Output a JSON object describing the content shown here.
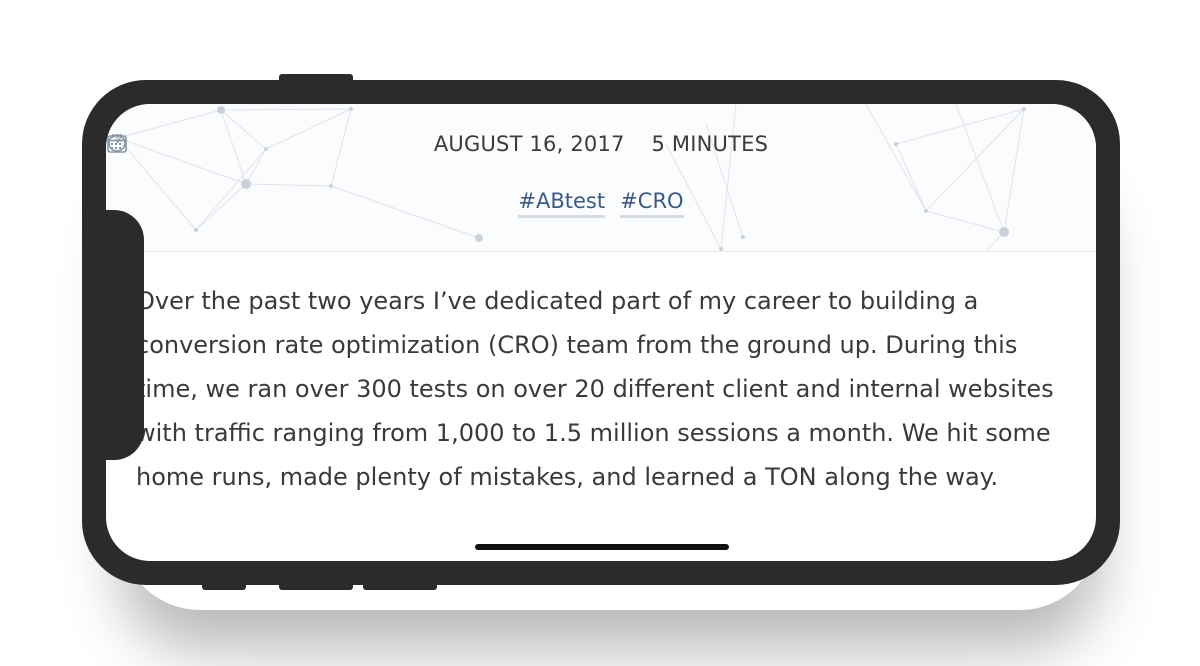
{
  "post": {
    "date": "AUGUST 16, 2017",
    "read_time": "5 MINUTES",
    "tags": [
      "#ABtest",
      "#CRO"
    ],
    "paragraph": "Over the past two years I’ve dedicated part of my career to building a conversion rate optimization (CRO) team from the ground up. During this time, we ran over 300 tests on over 20 different client and internal websites with traffic ranging from 1,000 to 1.5 million sessions a month. We hit some home runs, made plenty of mistakes, and learned a TON along the way."
  },
  "colors": {
    "text": "#3a3a3a",
    "tag": "#3c5a82",
    "phone_frame": "#2b2b2b"
  },
  "icons": [
    "calendar-icon",
    "clock-icon"
  ]
}
